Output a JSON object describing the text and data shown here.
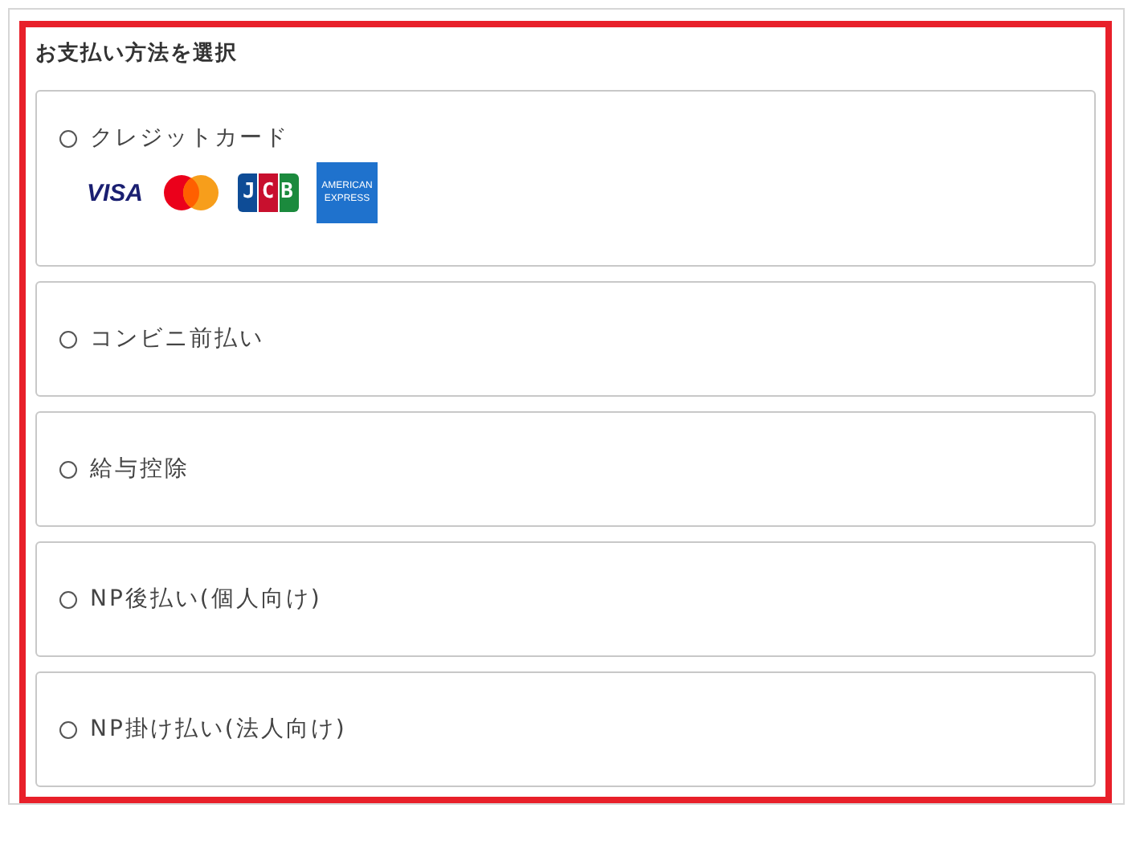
{
  "title": "お支払い方法を選択",
  "options": [
    {
      "label": "クレジットカード",
      "selected": false,
      "logos": [
        {
          "kind": "visa",
          "text": "VISA"
        },
        {
          "kind": "mastercard"
        },
        {
          "kind": "jcb",
          "text": "JCB"
        },
        {
          "kind": "amex",
          "lines": [
            "AMERICAN",
            "EXPRESS"
          ]
        }
      ]
    },
    {
      "label": "コンビニ前払い",
      "selected": false
    },
    {
      "label": "給与控除",
      "selected": false
    },
    {
      "label": "NP後払い(個人向け)",
      "selected": false
    },
    {
      "label": "NP掛け払い(法人向け)",
      "selected": false
    }
  ]
}
